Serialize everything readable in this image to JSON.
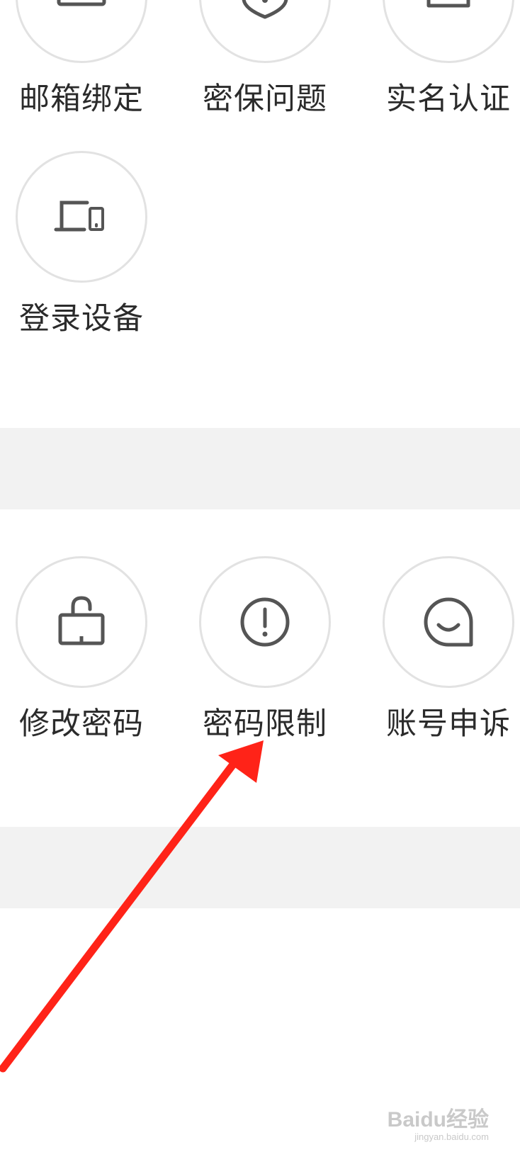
{
  "section1": {
    "items": [
      {
        "label": "邮箱绑定",
        "icon": "mail-icon"
      },
      {
        "label": "密保问题",
        "icon": "shield-question-icon"
      },
      {
        "label": "实名认证",
        "icon": "person-id-icon"
      },
      {
        "label": "登录设备",
        "icon": "devices-icon"
      }
    ]
  },
  "section2": {
    "items": [
      {
        "label": "修改密码",
        "icon": "unlock-icon"
      },
      {
        "label": "密码限制",
        "icon": "exclamation-circle-icon"
      },
      {
        "label": "账号申诉",
        "icon": "chat-smile-icon"
      }
    ]
  },
  "annotation": {
    "arrow_color": "#ff2318",
    "target": "密码限制"
  },
  "watermark": {
    "main": "Baidu经验",
    "sub": "jingyan.baidu.com"
  },
  "colors": {
    "icon": "#555555",
    "circle_border": "#e2e2e2",
    "divider": "#f2f2f2",
    "text": "#2b2b2b"
  }
}
